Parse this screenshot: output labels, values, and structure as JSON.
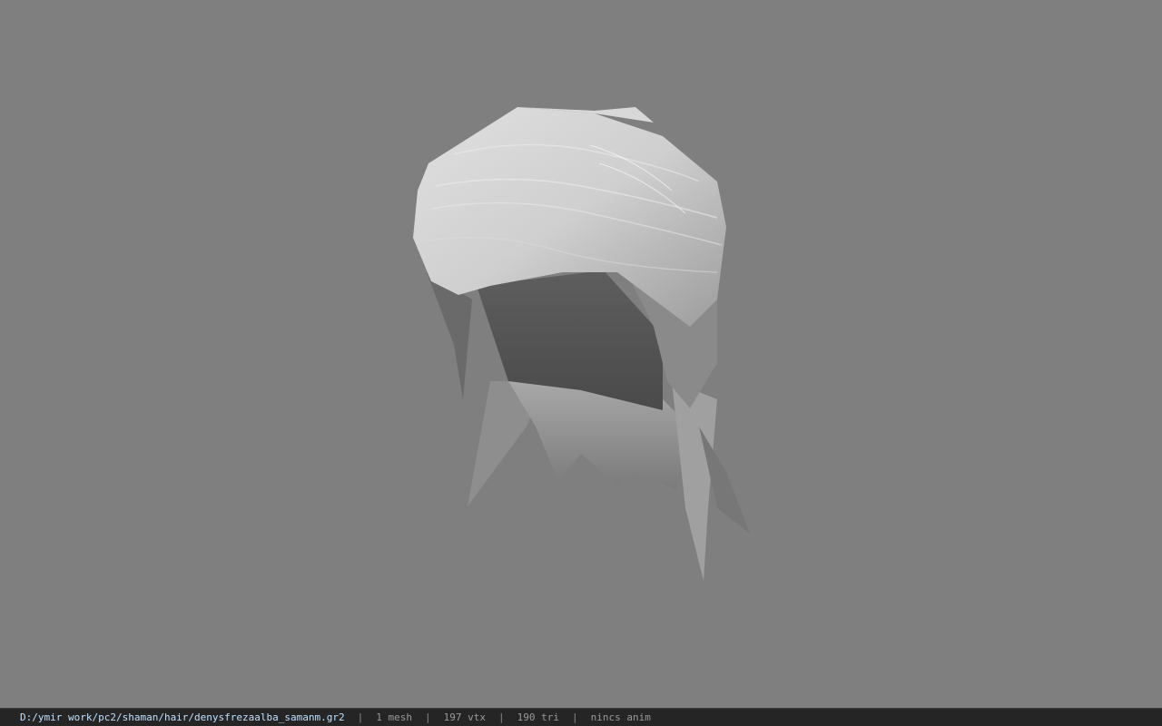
{
  "viewport": {
    "background_color": "#7f7f7f",
    "model_icon": "hair-mesh-render"
  },
  "statusbar": {
    "file_path": "D:/ymir work/pc2/shaman/hair/denysfrezaalba_samanm.gr2",
    "separator": "|",
    "mesh_count": "1 mesh",
    "vertex_count": "197 vtx",
    "triangle_count": "190 tri",
    "anim_info": "nincs anim",
    "path_color": "#bfe0ff",
    "field_color": "#9a9a9a"
  }
}
